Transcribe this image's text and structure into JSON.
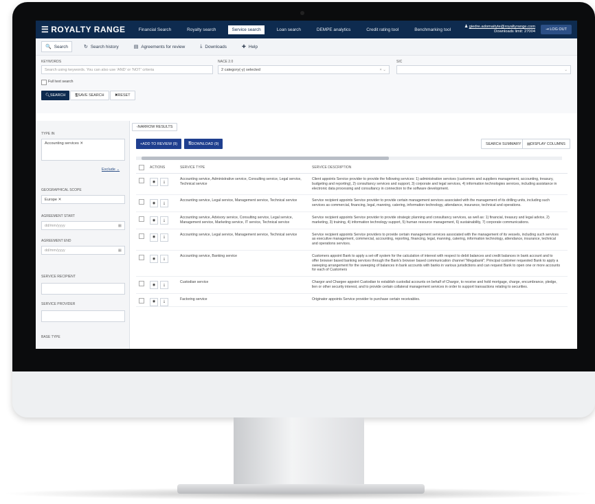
{
  "brand": {
    "name": "ROYALTY RANGE"
  },
  "nav": {
    "items": [
      {
        "label": "Financial Search"
      },
      {
        "label": "Royalty search"
      },
      {
        "label": "Service search",
        "active": true
      },
      {
        "label": "Loan search"
      },
      {
        "label": "DEMPE analytics"
      },
      {
        "label": "Credit rating tool"
      },
      {
        "label": "Benchmarking tool"
      }
    ],
    "user_email": "giedre.adomaityte@royaltyrange.com",
    "downloads_limit": "Downloads limit: 27004",
    "logout_label": "LOG OUT"
  },
  "subnav": {
    "items": [
      {
        "label": "Search",
        "icon": "search-icon",
        "active": true
      },
      {
        "label": "Search history",
        "icon": "history-icon"
      },
      {
        "label": "Agreements for review",
        "icon": "document-icon"
      },
      {
        "label": "Downloads",
        "icon": "download-icon"
      },
      {
        "label": "Help",
        "icon": "help-icon"
      }
    ]
  },
  "filters": {
    "keywords_label": "KEYWORDS",
    "keywords_placeholder": "Search using keywords. You can also use 'AND' or 'NOT' criteria",
    "nace_label": "NACE 2.0",
    "nace_value": "2 category(-y) selected",
    "sic_label": "SIC",
    "full_text_label": "Full text search",
    "search_button": "SEARCH",
    "save_search_button": "SAVE SEARCH",
    "reset_button": "RESET"
  },
  "sidebar": {
    "type_in_label": "TYPE IN",
    "type_in_chip": "Accounting services",
    "exclude_label": "Exclude",
    "geo_label": "GEOGRAPHICAL SCOPE",
    "geo_chip": "Europe",
    "agreement_start_label": "AGREEMENT START",
    "agreement_end_label": "AGREEMENT END",
    "date_placeholder": "dd/mm/yyyy",
    "service_recipient_label": "SERVICE RECIPIENT",
    "service_provider_label": "SERVICE PROVIDER",
    "base_type_label": "BASE TYPE"
  },
  "toolbar": {
    "narrow_results": "NARROW RESULTS",
    "add_to_review": "ADD TO REVIEW (9)",
    "download": "DOWNLOAD (9)",
    "search_summary": "SEARCH SUMMARY",
    "display_columns": "DISPLAY COLUMNS"
  },
  "table": {
    "headers": [
      "ACTIONS",
      "SERVICE TYPE",
      "SERVICE DESCRIPTION"
    ],
    "rows": [
      {
        "type": "Accounting service, Administrative service, Consulting service, Legal service, Technical service",
        "desc": "Client appoints Service provider to provide the following services: 1) administration services (customers and suppliers management, accounting, treasury, budgeting and reporting), 2) consultancy services and support, 3) corporate and legal services, 4) information technologies services, including assistance in electronic data processing and consultancy in connection to the software development."
      },
      {
        "type": "Accounting service, Legal service, Management service, Technical service",
        "desc": "Service recipient appoints Service provider to provide certain management services associated with the management of its drilling units, including such services as commercial, financing, legal, manning, catering, information technology, attendance, insurance, technical and operations."
      },
      {
        "type": "Accounting service, Advisory service, Consulting service, Legal service, Management service, Marketing service, IT service, Technical service",
        "desc": "Service recipient appoints Service provider to provide strategic planning and consultancy services, as well as: 1) financial, treasury and legal advice, 2) marketing, 3) training, 4) information technology support, 5) human resource management, 6) sustainability, 7) corporate communications."
      },
      {
        "type": "Accounting service, Legal service, Management service, Technical service",
        "desc": "Service recipient appoints Service providers to provide certain management services associated with the management of its vessels, including such services as executive management, commercial, accounting, reporting, financing, legal, manning, catering, information technology, attendance, insurance, technical and operations services."
      },
      {
        "type": "Accounting service, Banking service",
        "desc": "Customers appoint Bank to apply a set-off system for the calculation of interest with respect to debit balances and credit balances in bank account and to offer browser based banking services through the Bank's browser based communication channel \"Megabank\"; Principal customer requested Bank to apply a sweeping arrangement for the sweeping of balances in bank accounts with banks in various jurisdictions and can request Bank to open one or more accounts for each of Customers"
      },
      {
        "type": "Custodian service",
        "desc": "Chargor and Chargee appoint Custodian to establish custodial accounts on behalf of Chargor, to receive and hold mortgage, charge, encumbrance, pledge, lien or other security interest, and to provide certain collateral management services in order to support transactions relating to securities."
      },
      {
        "type": "Factoring service",
        "desc": "Originator appoints Service provider to purchase certain receivables."
      }
    ]
  }
}
